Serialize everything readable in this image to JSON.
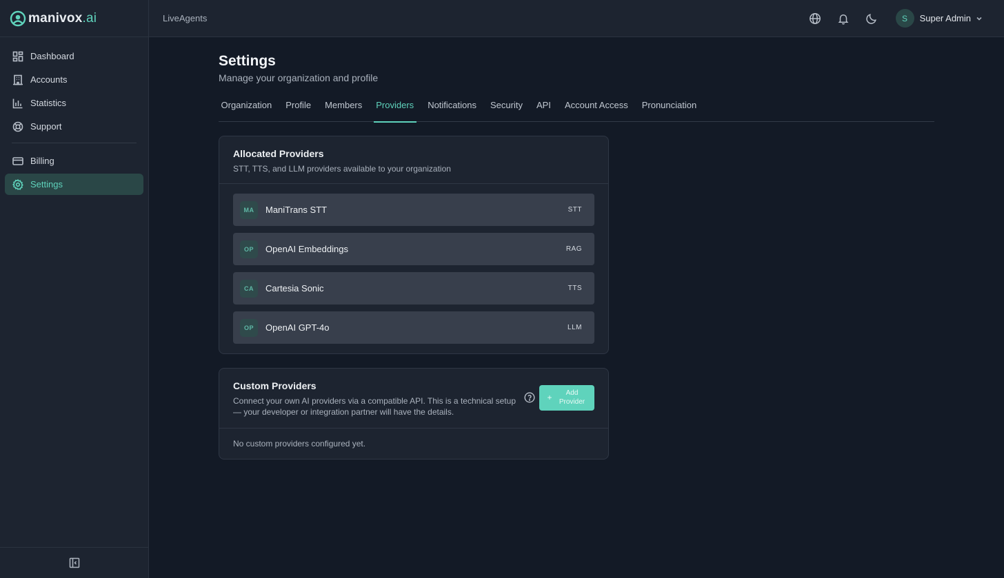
{
  "app": {
    "logo_main": "manivox",
    "logo_dot": ".",
    "logo_ai": "ai"
  },
  "sidebar": {
    "items": [
      {
        "label": "Dashboard",
        "icon": "dashboard-icon",
        "active": false
      },
      {
        "label": "Accounts",
        "icon": "building-icon",
        "active": false
      },
      {
        "label": "Statistics",
        "icon": "bar-chart-icon",
        "active": false
      },
      {
        "label": "Support",
        "icon": "lifebuoy-icon",
        "active": false
      }
    ],
    "items2": [
      {
        "label": "Billing",
        "icon": "credit-card-icon",
        "active": false
      },
      {
        "label": "Settings",
        "icon": "gear-icon",
        "active": true
      }
    ]
  },
  "header": {
    "breadcrumb": "LiveAgents",
    "user": {
      "initial": "S",
      "name": "Super Admin"
    }
  },
  "page": {
    "title": "Settings",
    "subtitle": "Manage your organization and profile",
    "tabs": [
      "Organization",
      "Profile",
      "Members",
      "Providers",
      "Notifications",
      "Security",
      "API",
      "Account Access",
      "Pronunciation"
    ],
    "active_tab": "Providers"
  },
  "allocated": {
    "title": "Allocated Providers",
    "description": "STT, TTS, and LLM providers available to your organization",
    "providers": [
      {
        "badge": "MA",
        "name": "ManiTrans STT",
        "type": "STT"
      },
      {
        "badge": "OP",
        "name": "OpenAI Embeddings",
        "type": "RAG"
      },
      {
        "badge": "CA",
        "name": "Cartesia Sonic",
        "type": "TTS"
      },
      {
        "badge": "OP",
        "name": "OpenAI GPT-4o",
        "type": "LLM"
      }
    ]
  },
  "custom": {
    "title": "Custom Providers",
    "description": "Connect your own AI providers via a compatible API. This is a technical setup — your developer or integration partner will have the details.",
    "add_label_line1": "Add",
    "add_label_line2": "Provider",
    "add_icon": "+",
    "empty_text": "No custom providers configured yet."
  },
  "colors": {
    "accent": "#5fd3bc",
    "background": "#131a26",
    "surface": "#1d2430"
  }
}
